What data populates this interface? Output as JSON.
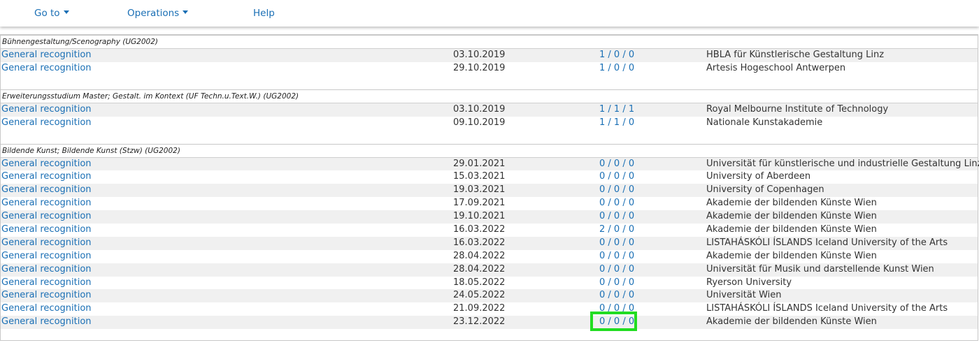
{
  "nav": {
    "goto": "Go to",
    "operations": "Operations",
    "help": "Help"
  },
  "groups": [
    {
      "title": "Bühnengestaltung/Scenography (UG2002)",
      "rows": [
        {
          "type": "General recognition",
          "date": "03.10.2019",
          "count": "1 / 0 / 0",
          "institution": "HBLA für Künstlerische Gestaltung Linz"
        },
        {
          "type": "General recognition",
          "date": "29.10.2019",
          "count": "1 / 0 / 0",
          "institution": "Artesis Hogeschool Antwerpen"
        }
      ]
    },
    {
      "title": "Erweiterungsstudium Master; Gestalt. im Kontext (UF Techn.u.Text.W.) (UG2002)",
      "rows": [
        {
          "type": "General recognition",
          "date": "03.10.2019",
          "count": "1 / 1 / 1",
          "institution": "Royal Melbourne Institute of Technology"
        },
        {
          "type": "General recognition",
          "date": "09.10.2019",
          "count": "1 / 1 / 0",
          "institution": "Nationale Kunstakademie"
        }
      ]
    },
    {
      "title": "Bildende Kunst; Bildende Kunst (Stzw) (UG2002)",
      "rows": [
        {
          "type": "General recognition",
          "date": "29.01.2021",
          "count": "0 / 0 / 0",
          "institution": "Universität für künstlerische und industrielle Gestaltung Linz"
        },
        {
          "type": "General recognition",
          "date": "15.03.2021",
          "count": "0 / 0 / 0",
          "institution": "University of Aberdeen"
        },
        {
          "type": "General recognition",
          "date": "19.03.2021",
          "count": "0 / 0 / 0",
          "institution": "University of Copenhagen"
        },
        {
          "type": "General recognition",
          "date": "17.09.2021",
          "count": "0 / 0 / 0",
          "institution": "Akademie der bildenden Künste Wien"
        },
        {
          "type": "General recognition",
          "date": "19.10.2021",
          "count": "0 / 0 / 0",
          "institution": "Akademie der bildenden Künste Wien"
        },
        {
          "type": "General recognition",
          "date": "16.03.2022",
          "count": "2 / 0 / 0",
          "institution": "Akademie der bildenden Künste Wien"
        },
        {
          "type": "General recognition",
          "date": "16.03.2022",
          "count": "0 / 0 / 0",
          "institution": "LISTAHÁSKÓLI ÍSLANDS Iceland University of the Arts"
        },
        {
          "type": "General recognition",
          "date": "28.04.2022",
          "count": "0 / 0 / 0",
          "institution": "Akademie der bildenden Künste Wien"
        },
        {
          "type": "General recognition",
          "date": "28.04.2022",
          "count": "0 / 0 / 0",
          "institution": "Universität für Musik und darstellende Kunst Wien"
        },
        {
          "type": "General recognition",
          "date": "18.05.2022",
          "count": "0 / 0 / 0",
          "institution": "Ryerson University"
        },
        {
          "type": "General recognition",
          "date": "24.05.2022",
          "count": "0 / 0 / 0",
          "institution": "Universität Wien"
        },
        {
          "type": "General recognition",
          "date": "21.09.2022",
          "count": "0 / 0 / 0",
          "institution": "LISTAHÁSKÓLI ÍSLANDS Iceland University of the Arts"
        },
        {
          "type": "General recognition",
          "date": "23.12.2022",
          "count": "0 / 0 / 0",
          "institution": "Akademie der bildenden Künste Wien"
        }
      ]
    }
  ],
  "colors": {
    "link": "#1a6fb5",
    "highlight": "#22dd22",
    "row_alt": "#f0f0f0"
  }
}
